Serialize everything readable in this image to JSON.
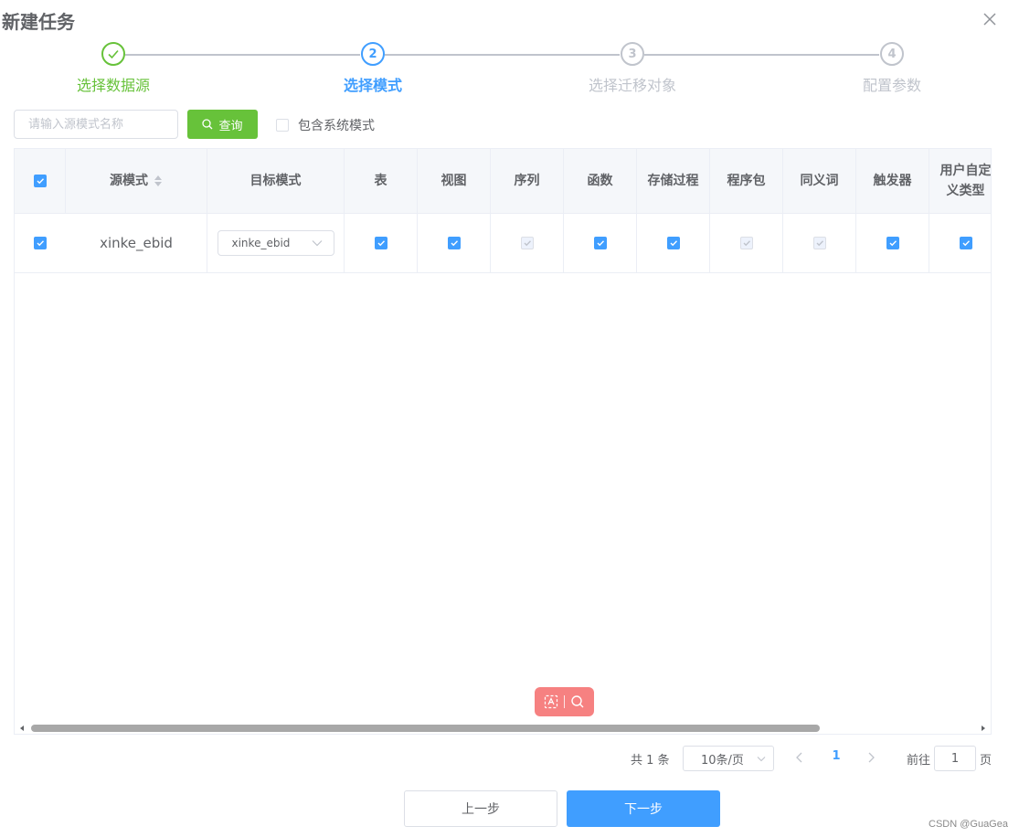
{
  "dialog": {
    "title": "新建任务",
    "close_icon": "close-icon"
  },
  "steps": [
    {
      "number": "1",
      "label": "选择数据源",
      "status": "success"
    },
    {
      "number": "2",
      "label": "选择模式",
      "status": "active"
    },
    {
      "number": "3",
      "label": "选择迁移对象",
      "status": "wait"
    },
    {
      "number": "4",
      "label": "配置参数",
      "status": "wait"
    }
  ],
  "toolbar": {
    "search_placeholder": "请输入源模式名称",
    "query_label": "查询",
    "include_system_label": "包含系统模式",
    "include_system_checked": false
  },
  "table": {
    "header_checkbox_checked": true,
    "columns": {
      "source_schema": "源模式",
      "target_schema": "目标模式",
      "table": "表",
      "view": "视图",
      "sequence": "序列",
      "function": "函数",
      "procedure": "存储过程",
      "package": "程序包",
      "synonym": "同义词",
      "trigger": "触发器",
      "udt_line1": "用户自定",
      "udt_line2": "义类型"
    },
    "rows": [
      {
        "checked": true,
        "source_schema": "xinke_ebid",
        "target_schema": "xinke_ebid",
        "table": "checked",
        "view": "checked",
        "sequence": "disabled-checked",
        "function": "checked",
        "procedure": "checked",
        "package": "disabled-checked",
        "synonym": "disabled-checked",
        "trigger": "checked",
        "udt": "checked"
      }
    ]
  },
  "pagination": {
    "total_text": "共 1 条",
    "page_size": "10条/页",
    "current_page": "1",
    "goto_label": "前往",
    "goto_value": "1",
    "page_suffix": "页"
  },
  "footer": {
    "prev_label": "上一步",
    "next_label": "下一步"
  },
  "watermark": "CSDN @GuaGea",
  "colors": {
    "primary": "#409eff",
    "success": "#67c23a",
    "muted": "#c0c4cc",
    "float_tool": "#f56c6c"
  }
}
